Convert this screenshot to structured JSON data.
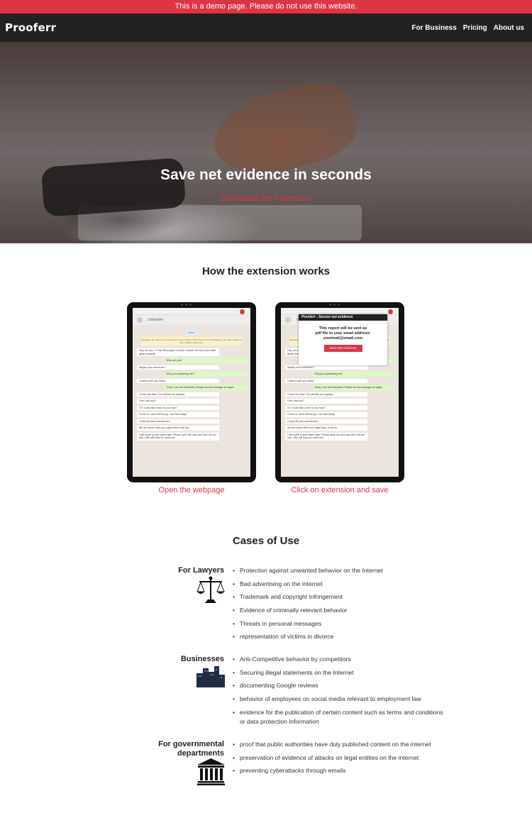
{
  "banner": {
    "text": "This is a demo page. Please do not use this website."
  },
  "nav": {
    "brand": "Prooferr",
    "links": [
      "For Business",
      "Pricing",
      "About us"
    ]
  },
  "hero": {
    "title": "Save net evidence in seconds",
    "subtitle": "Download the extension"
  },
  "how": {
    "title": "How the extension works",
    "steps": [
      {
        "caption": "Open the webpage"
      },
      {
        "caption": "Click on extension and save"
      }
    ],
    "mockup": {
      "contact": "Unknown",
      "today": "TODAY",
      "notice": "Messages are end-to-end encrypted. No one outside of this chat, not even WhatsApp, can read or listen to them. Click to learn more.",
      "messages": [
        {
          "dir": "in",
          "text": "Hey, are you J.? My friend gave me your number. Be sure you make great contacts."
        },
        {
          "dir": "out",
          "text": "Who are you?"
        },
        {
          "dir": "in",
          "text": "Maybe your secret fan?"
        },
        {
          "dir": "out",
          "text": "Why you contacting me?"
        },
        {
          "dir": "in",
          "text": "I want to see you today."
        },
        {
          "dir": "out",
          "text": "Sorry, I am not interested. Please do not message me again"
        },
        {
          "dir": "in",
          "text": "Come one dear. You will like me anyway"
        },
        {
          "dir": "in",
          "text": "Can I call you?"
        },
        {
          "dir": "in",
          "text": "Or I could also come to you now?"
        },
        {
          "dir": "in",
          "text": "Come on, don't kill the joy. I am free today"
        },
        {
          "dir": "in",
          "text": "I know all your secrets and ..."
        },
        {
          "dir": "in",
          "text": "We are closer than you might think, trust me"
        },
        {
          "dir": "in",
          "text": "I will come to your place later. Please open the door and don't be too shy :) We will have so much fun."
        }
      ],
      "popup": {
        "header": "Prooferr - Secure net evidence",
        "line1": "This report will be sent as",
        "line2": "pdf file to your email address:",
        "email": "yourmail@email.com",
        "button": "Save this evidence"
      }
    }
  },
  "cases": {
    "title": "Cases of Use",
    "groups": [
      {
        "label": "For Lawyers",
        "icon": "scales-icon",
        "items": [
          "Protection against unwanted behavior on the Internet",
          "Bad advertising on the internet",
          "Trademark and copyright infringement",
          "Evidence of criminally relevant behavior",
          "Threats in personal messages",
          "representation of victims in divorce"
        ]
      },
      {
        "label": "Businesses",
        "icon": "buildings-icon",
        "items": [
          "Anti-Competitive behavior by competitors",
          "Securing illegal statements on the Internet",
          "documenting Google reviews",
          "behavior of employees on social media relevant to employment law",
          "evidence for the publication of certain content such as terms and conditions or data protection information"
        ]
      },
      {
        "label_line1": "For governmental",
        "label_line2": "departments",
        "icon": "government-building-icon",
        "items": [
          "proof that public authorities have duly published content on the internet",
          "preservation of evidence of attacks on legal entities on the internet",
          "preventing cyberattacks through emails"
        ]
      }
    ]
  },
  "colors": {
    "accent": "#dc3545",
    "nav_bg": "#222222",
    "text": "#222222"
  }
}
